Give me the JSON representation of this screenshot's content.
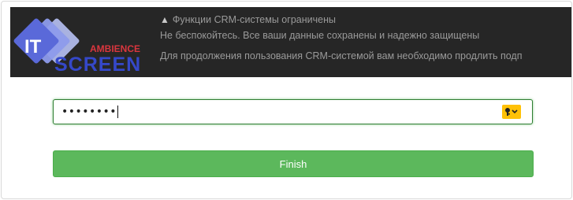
{
  "logo": {
    "mark_text": "IT",
    "subtitle": "AMBIENCE",
    "wordmark": "SCREEN",
    "colors": {
      "squares": [
        "#a9b6f3",
        "#7f8ee6",
        "#4f5fd6"
      ],
      "wordmark": "#3548c9",
      "subtitle": "#d9363e"
    }
  },
  "notice": {
    "icon": "warning-triangle-icon",
    "title": "Функции CRM-системы ограничены",
    "line1": "Не беспокойтесь. Все ваши данные сохранены и надежно защищены",
    "line2": "Для продолжения пользования CRM-системой вам необходимо продлить подп"
  },
  "password": {
    "value": "••••••••",
    "key_button_icon": "key-dropdown-icon"
  },
  "finish_label": "Finish",
  "colors": {
    "banner": "#262626",
    "focus_border": "#2e7d32",
    "finish_button": "#5cb85c",
    "key_button": "#ffc107"
  }
}
